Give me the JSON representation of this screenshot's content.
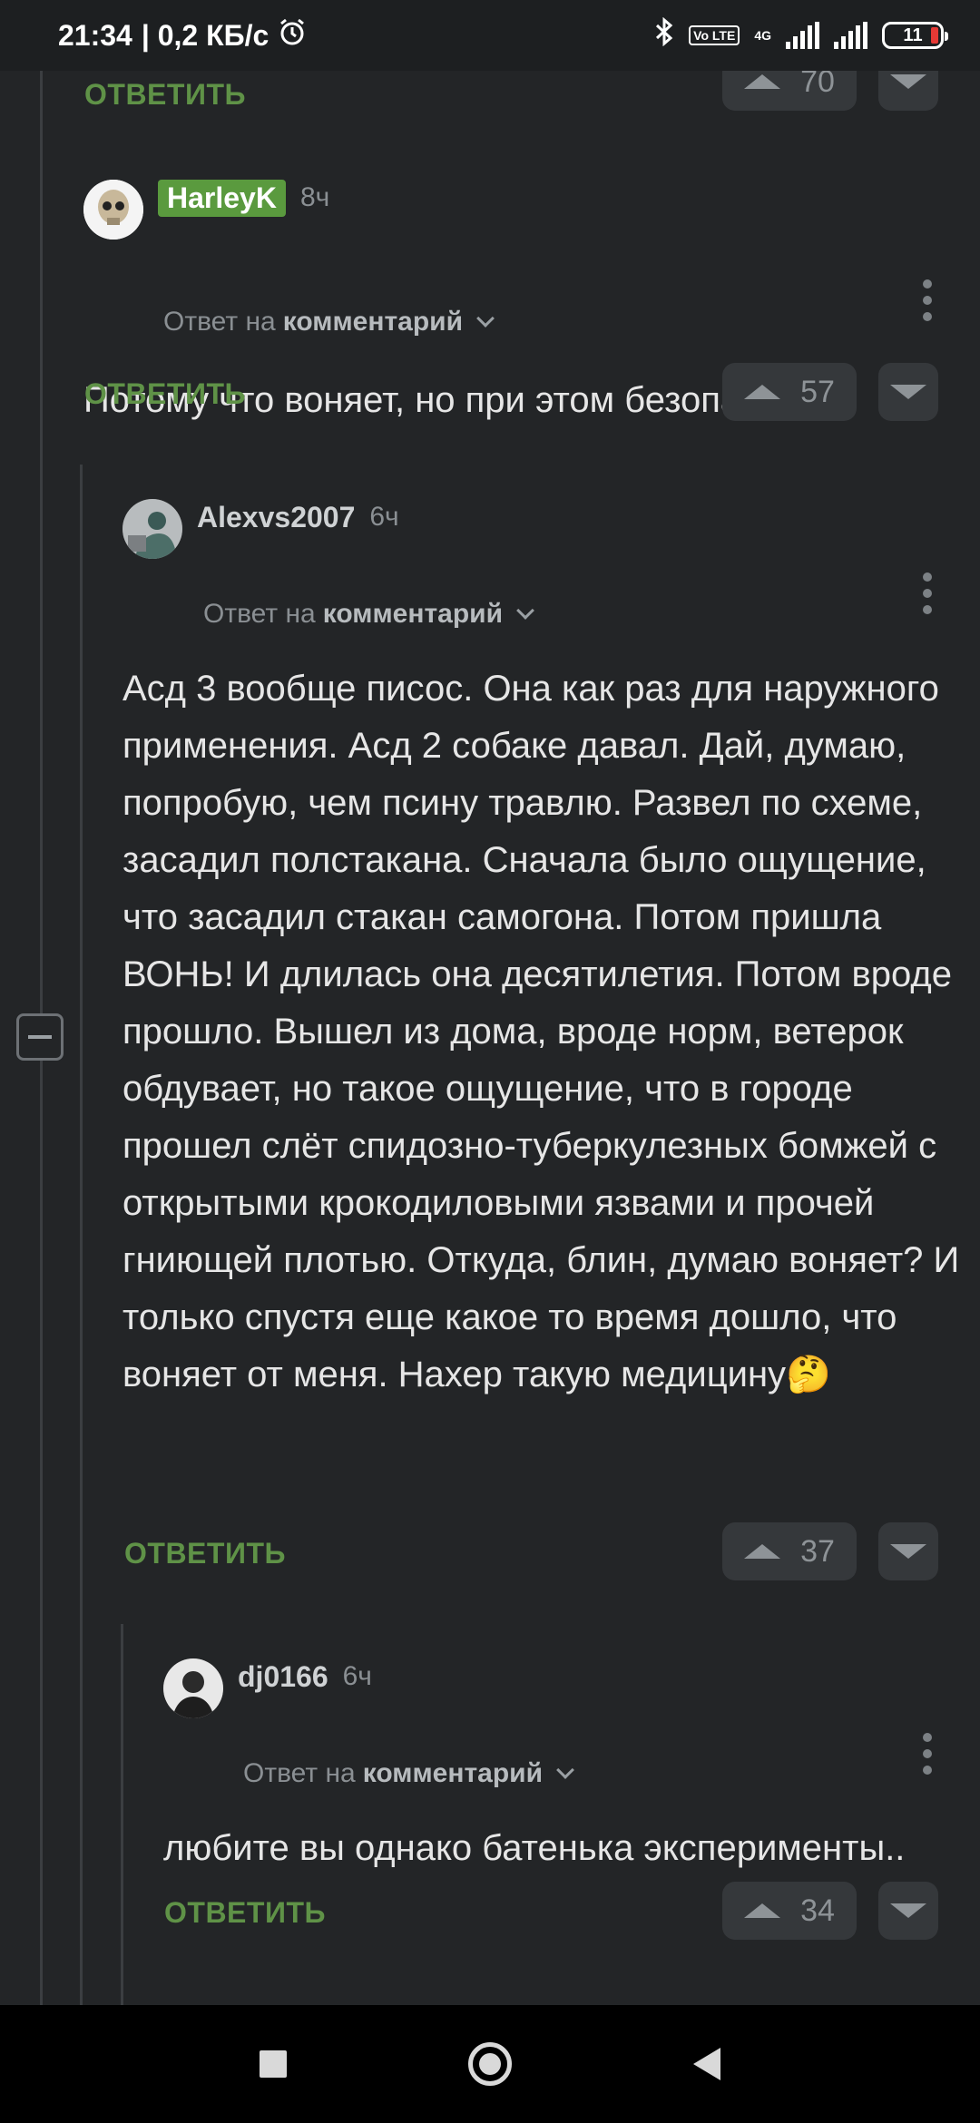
{
  "status_bar": {
    "time": "21:34",
    "speed": "| 0,2 КБ/с",
    "network_type": "4G",
    "volte": "Vo LTE",
    "battery": "11"
  },
  "comments": [
    {
      "reply_label": "ОТВЕТИТЬ",
      "votes": "70"
    },
    {
      "author": "HarleyK",
      "time": "8ч",
      "reply_to_prefix": "Ответ на",
      "reply_to_target": "комментарий",
      "text": "Потому что воняет, но при этом безопасна.",
      "reply_label": "ОТВЕТИТЬ",
      "votes": "57"
    },
    {
      "author": "Alexvs2007",
      "time": "6ч",
      "reply_to_prefix": "Ответ на",
      "reply_to_target": "комментарий",
      "text": "Асд 3 вообще писос. Она как раз для наружного применения. Асд 2 собаке давал. Дай, думаю, попробую, чем псину травлю. Развел по схеме, засадил полстакана. Сначала было ощущение, что засадил стакан самогона. Потом пришла ВОНЬ! И длилась она десятилетия. Потом вроде прошло. Вышел из дома, вроде норм, ветерок обдувает, но такое ощущение, что в городе прошел слёт спидозно-туберкулезных бомжей с открытыми крокодиловыми язвами и прочей гниющей плотью. Откуда, блин, думаю воняет? И только спустя еще какое то время дошло, что воняет от меня. Нахер такую медицину🤔",
      "reply_label": "ОТВЕТИТЬ",
      "votes": "37"
    },
    {
      "author": "dj0166",
      "time": "6ч",
      "reply_to_prefix": "Ответ на",
      "reply_to_target": "комментарий",
      "text": "любите вы однако батенька эксперименты..",
      "reply_label": "ОТВЕТИТЬ",
      "votes": "34"
    }
  ],
  "colors": {
    "background": "#232527",
    "reply_green": "#5f9247",
    "badge_green": "#5a9a3e"
  }
}
